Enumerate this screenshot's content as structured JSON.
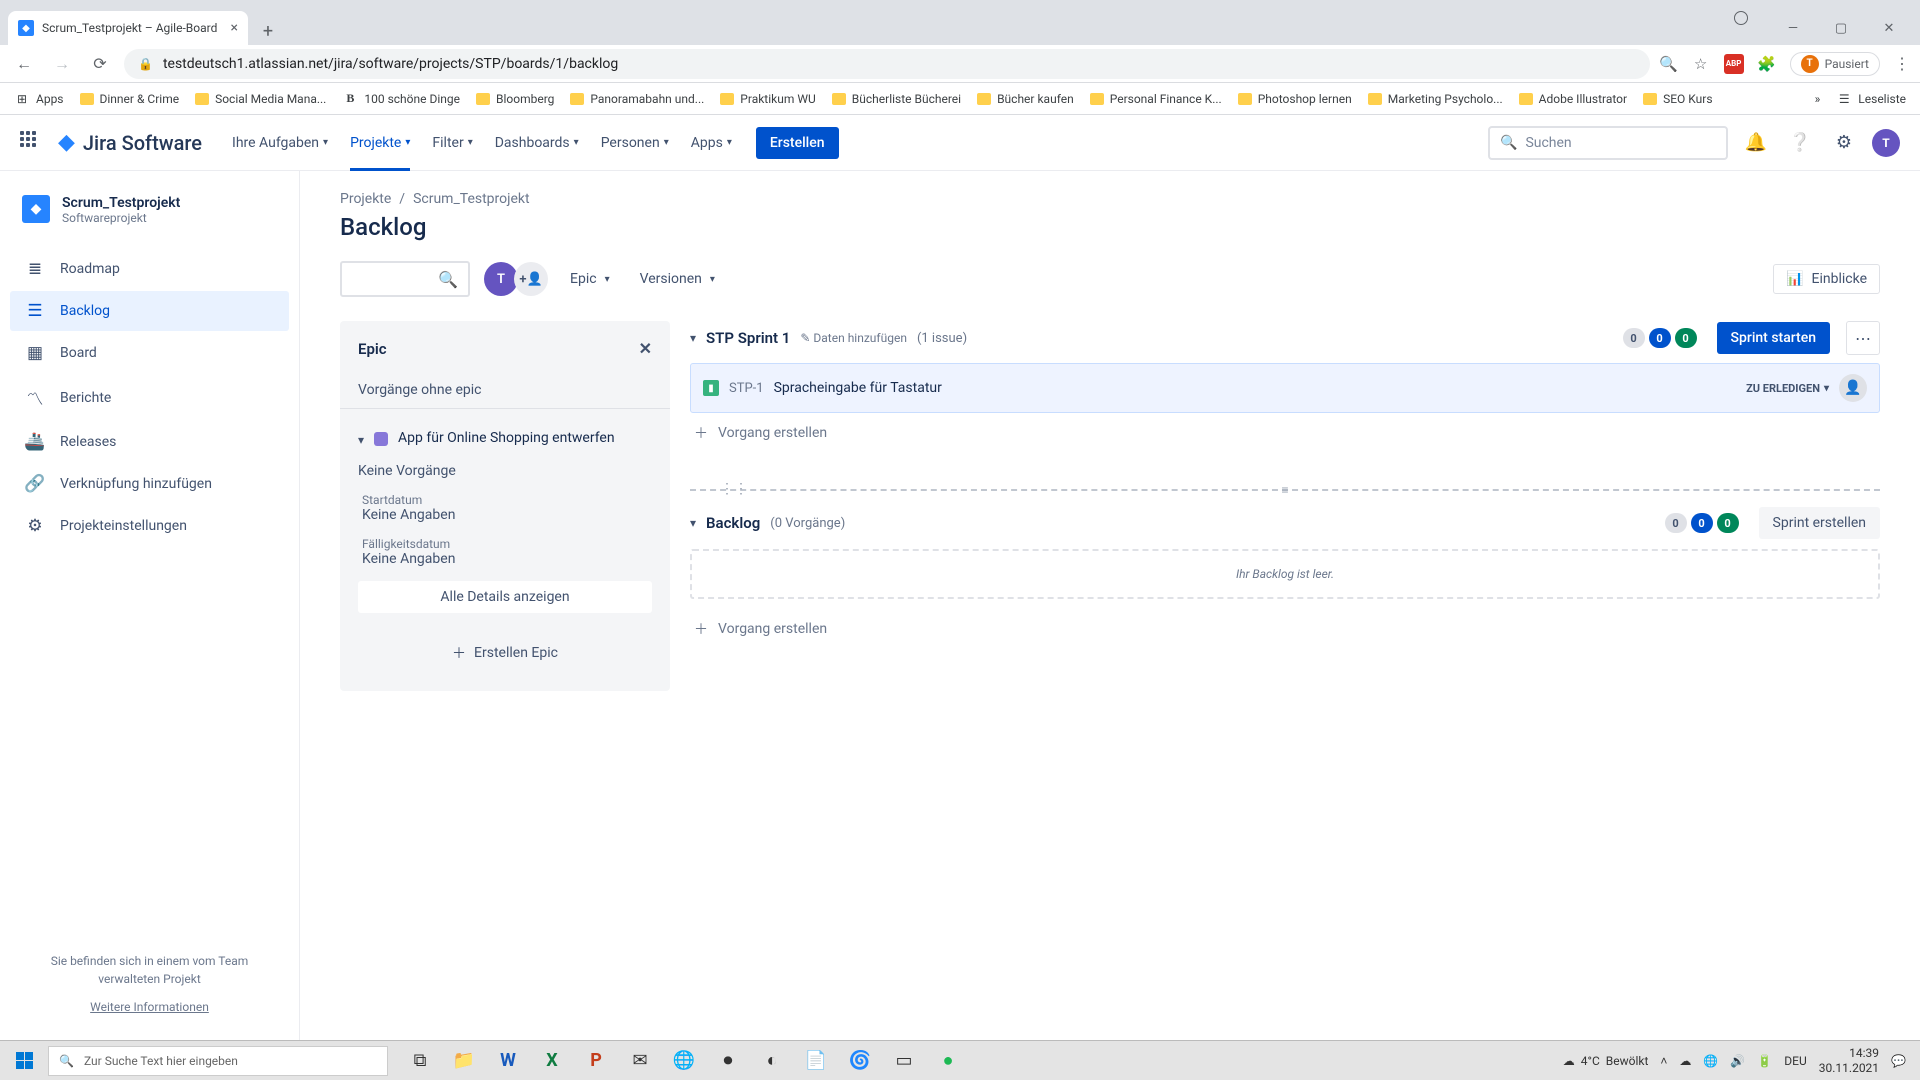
{
  "browser": {
    "tab_title": "Scrum_Testprojekt – Agile-Board",
    "url": "testdeutsch1.atlassian.net/jira/software/projects/STP/boards/1/backlog",
    "paused_label": "Pausiert",
    "bookmarks": [
      "Apps",
      "Dinner & Crime",
      "Social Media Mana...",
      "100 schöne Dinge",
      "Bloomberg",
      "Panoramabahn und...",
      "Praktikum WU",
      "Bücherliste Bücherei",
      "Bücher kaufen",
      "Personal Finance K...",
      "Photoshop lernen",
      "Marketing Psycholo...",
      "Adobe Illustrator",
      "SEO Kurs"
    ],
    "reading_list": "Leseliste"
  },
  "jira_header": {
    "product": "Jira Software",
    "nav": [
      "Ihre Aufgaben",
      "Projekte",
      "Filter",
      "Dashboards",
      "Personen",
      "Apps"
    ],
    "active_nav_index": 1,
    "create": "Erstellen",
    "search_placeholder": "Suchen"
  },
  "sidebar": {
    "project_name": "Scrum_Testprojekt",
    "project_type": "Softwareprojekt",
    "items": [
      {
        "label": "Roadmap"
      },
      {
        "label": "Backlog"
      },
      {
        "label": "Board"
      },
      {
        "label": "Berichte"
      },
      {
        "label": "Releases"
      },
      {
        "label": "Verknüpfung hinzufügen"
      },
      {
        "label": "Projekteinstellungen"
      }
    ],
    "active_index": 1,
    "footer_text": "Sie befinden sich in einem vom Team verwalteten Projekt",
    "footer_link": "Weitere Informationen"
  },
  "breadcrumbs": [
    "Projekte",
    "Scrum_Testprojekt"
  ],
  "page_title": "Backlog",
  "toolbar": {
    "epic": "Epic",
    "versions": "Versionen",
    "insights": "Einblicke"
  },
  "epic_panel": {
    "title": "Epic",
    "no_epic": "Vorgänge ohne epic",
    "epic_name": "App für Online Shopping entwerfen",
    "no_issues": "Keine Vorgänge",
    "start_label": "Startdatum",
    "start_value": "Keine Angaben",
    "due_label": "Fälligkeitsdatum",
    "due_value": "Keine Angaben",
    "all_details": "Alle Details anzeigen",
    "create_epic": "Erstellen Epic"
  },
  "sprint": {
    "name": "STP Sprint 1",
    "add_dates": "Daten hinzufügen",
    "count": "(1 issue)",
    "pills": {
      "todo": "0",
      "inprog": "0",
      "done": "0"
    },
    "start_btn": "Sprint starten",
    "issue": {
      "key": "STP-1",
      "summary": "Spracheingabe für Tastatur",
      "status": "ZU ERLEDIGEN"
    },
    "create_issue": "Vorgang erstellen"
  },
  "backlog": {
    "name": "Backlog",
    "count": "(0 Vorgänge)",
    "pills": {
      "todo": "0",
      "inprog": "0",
      "done": "0"
    },
    "create_sprint": "Sprint erstellen",
    "empty": "Ihr Backlog ist leer.",
    "create_issue": "Vorgang erstellen"
  },
  "taskbar": {
    "search_placeholder": "Zur Suche Text hier eingeben",
    "weather_temp": "4°C",
    "weather_cond": "Bewölkt",
    "lang": "DEU",
    "time": "14:39",
    "date": "30.11.2021"
  }
}
